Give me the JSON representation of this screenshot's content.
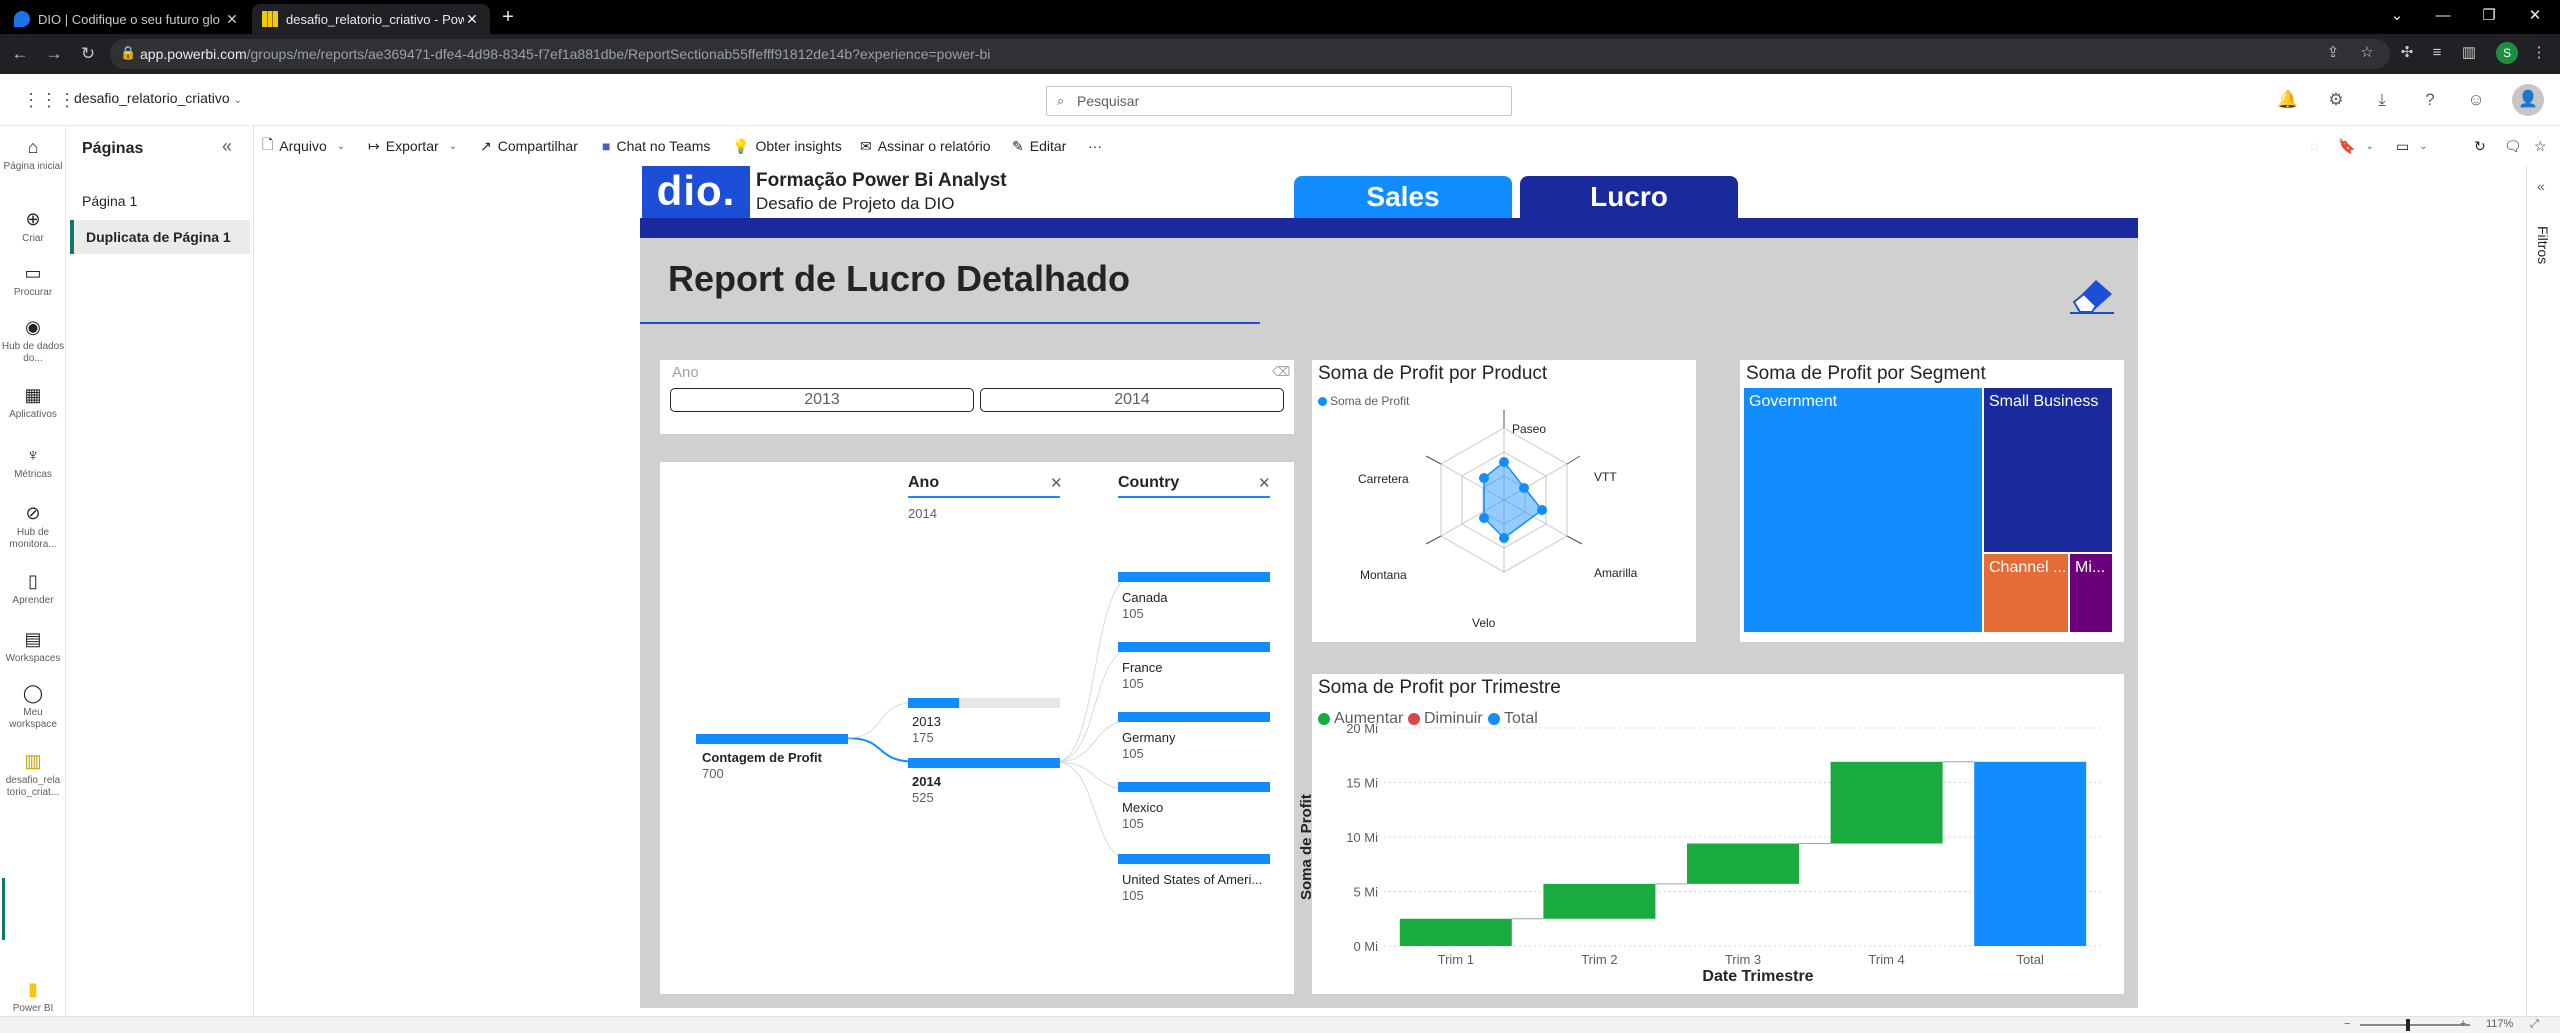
{
  "browser": {
    "tabs": [
      {
        "title": "DIO | Codifique o seu futuro glo"
      },
      {
        "title": "desafio_relatorio_criativo - Pow"
      }
    ],
    "url_host": "app.powerbi.com",
    "url_path": "/groups/me/reports/ae369471-dfe4-4d98-8345-f7ef1a881dbe/ReportSectionab55ffefff91812de14b?experience=power-bi",
    "profile_initial": "S"
  },
  "header": {
    "report_name": "desafio_relatorio_criativo",
    "search_placeholder": "Pesquisar"
  },
  "rail": {
    "items": [
      {
        "label": "Página inicial",
        "icon": "home-icon"
      },
      {
        "label": "Criar",
        "icon": "plus-icon"
      },
      {
        "label": "Procurar",
        "icon": "folder-icon"
      },
      {
        "label": "Hub de dados do...",
        "icon": "data-hub-icon"
      },
      {
        "label": "Aplicativos",
        "icon": "apps-icon"
      },
      {
        "label": "Métricas",
        "icon": "trophy-icon"
      },
      {
        "label": "Hub de monitora...",
        "icon": "monitor-icon"
      },
      {
        "label": "Aprender",
        "icon": "book-icon"
      },
      {
        "label": "Workspaces",
        "icon": "workspaces-icon"
      },
      {
        "label": "Meu workspace",
        "icon": "person-icon"
      },
      {
        "label": "desafio_rela torio_criat...",
        "icon": "report-icon"
      }
    ],
    "bottom_label": "Power BI"
  },
  "pages_pane": {
    "title": "Páginas",
    "pages": [
      "Página 1",
      "Duplicata de Página 1"
    ]
  },
  "actions": {
    "arquivo": "Arquivo",
    "exportar": "Exportar",
    "compartilhar": "Compartilhar",
    "chat_teams": "Chat no Teams",
    "insights": "Obter insights",
    "assinar": "Assinar o relatório",
    "editar": "Editar",
    "more": "···"
  },
  "report": {
    "logo": "dio.",
    "title": "Formação Power Bi Analyst",
    "subtitle": "Desafio de Projeto da DIO",
    "tab_sales": "Sales",
    "tab_lucro": "Lucro",
    "heading": "Report de Lucro Detalhado",
    "colors": {
      "accent": "#118dff",
      "navy": "#1a2a9c",
      "logo_blue": "#1d4ed8",
      "green": "#1aab40",
      "red": "#d64550"
    }
  },
  "slicer": {
    "label": "Ano",
    "options": [
      "2013",
      "2014"
    ]
  },
  "decomposition": {
    "col1": {
      "header": "Ano",
      "sub": "2014"
    },
    "col2": {
      "header": "Country"
    },
    "root": {
      "label": "Contagem de Profit",
      "value": "700"
    },
    "years": [
      {
        "label": "2013",
        "value": "175",
        "fraction": 0.333
      },
      {
        "label": "2014",
        "value": "525",
        "fraction": 1.0
      }
    ],
    "countries": [
      {
        "label": "Canada",
        "value": "105"
      },
      {
        "label": "France",
        "value": "105"
      },
      {
        "label": "Germany",
        "value": "105"
      },
      {
        "label": "Mexico",
        "value": "105"
      },
      {
        "label": "United States of Ameri...",
        "value": "105"
      }
    ]
  },
  "radar": {
    "title": "Soma de Profit por Product",
    "legend": "Soma de Profit",
    "axes": [
      "Paseo",
      "VTT",
      "Amarilla",
      "Velo",
      "Montana",
      "Carretera"
    ]
  },
  "treemap": {
    "title": "Soma de Profit por Segment",
    "tiles": [
      {
        "label": "Government",
        "color": "#118dff"
      },
      {
        "label": "Small Business",
        "color": "#1a2a9c"
      },
      {
        "label": "Channel ...",
        "color": "#e66c37"
      },
      {
        "label": "Mi...",
        "color": "#6b007b"
      }
    ]
  },
  "chart_data": {
    "type": "bar",
    "subtype": "waterfall",
    "title": "Soma de Profit por Trimestre",
    "xlabel": "Date Trimestre",
    "ylabel": "Soma de Profit",
    "categories": [
      "Trim 1",
      "Trim 2",
      "Trim 3",
      "Trim 4",
      "Total"
    ],
    "values": [
      2.5,
      3.2,
      3.7,
      7.5,
      16.9
    ],
    "ylim": [
      0,
      20
    ],
    "yticks": [
      "0 Mi",
      "5 Mi",
      "10 Mi",
      "15 Mi",
      "20 Mi"
    ],
    "legend": [
      "Aumentar",
      "Diminuir",
      "Total"
    ],
    "grid": true
  },
  "status": {
    "zoom": "117%"
  },
  "filters": {
    "label": "Filtros"
  }
}
